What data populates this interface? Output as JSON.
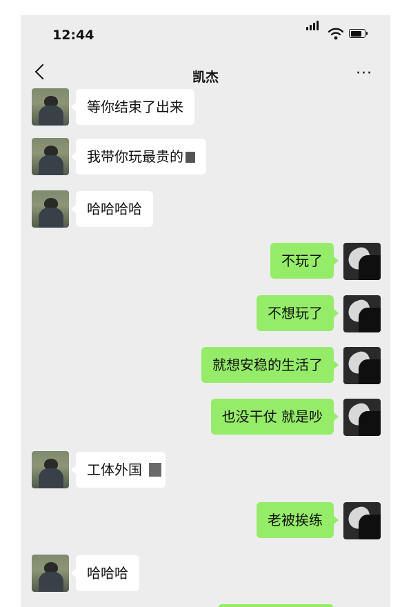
{
  "status_bar": {
    "time": "12:44"
  },
  "header": {
    "title": "凯杰",
    "more": "···"
  },
  "messages": [
    {
      "side": "left",
      "text": "等你结束了出来"
    },
    {
      "side": "left",
      "text": "我带你玩最贵的"
    },
    {
      "side": "left",
      "text": "哈哈哈哈"
    },
    {
      "side": "right",
      "text": "不玩了"
    },
    {
      "side": "right",
      "text": "不想玩了"
    },
    {
      "side": "right",
      "text": "就想安稳的生活了"
    },
    {
      "side": "right",
      "text": "也没干仗 就是吵"
    },
    {
      "side": "left",
      "text": "工体外国"
    },
    {
      "side": "right",
      "text": "老被挨练"
    },
    {
      "side": "left",
      "text": "哈哈哈"
    }
  ],
  "colors": {
    "chat_bg": "#ededed",
    "sent_bubble": "#95ec69",
    "received_bubble": "#ffffff"
  }
}
